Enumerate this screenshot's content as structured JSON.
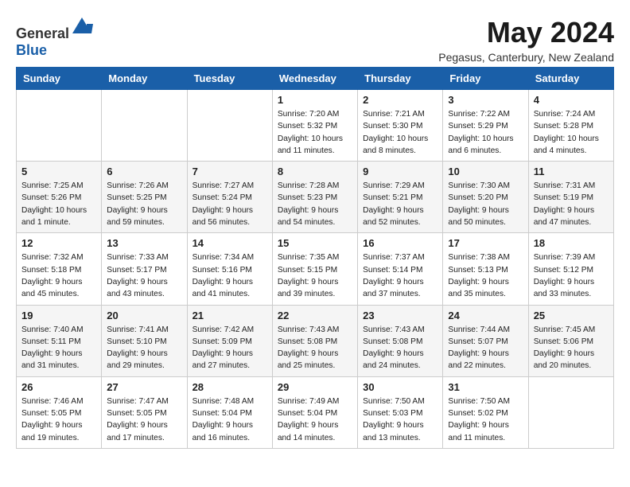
{
  "header": {
    "logo_general": "General",
    "logo_blue": "Blue",
    "title": "May 2024",
    "subtitle": "Pegasus, Canterbury, New Zealand"
  },
  "weekdays": [
    "Sunday",
    "Monday",
    "Tuesday",
    "Wednesday",
    "Thursday",
    "Friday",
    "Saturday"
  ],
  "weeks": [
    [
      {
        "day": "",
        "sunrise": "",
        "sunset": "",
        "daylight": ""
      },
      {
        "day": "",
        "sunrise": "",
        "sunset": "",
        "daylight": ""
      },
      {
        "day": "",
        "sunrise": "",
        "sunset": "",
        "daylight": ""
      },
      {
        "day": "1",
        "sunrise": "Sunrise: 7:20 AM",
        "sunset": "Sunset: 5:32 PM",
        "daylight": "Daylight: 10 hours and 11 minutes."
      },
      {
        "day": "2",
        "sunrise": "Sunrise: 7:21 AM",
        "sunset": "Sunset: 5:30 PM",
        "daylight": "Daylight: 10 hours and 8 minutes."
      },
      {
        "day": "3",
        "sunrise": "Sunrise: 7:22 AM",
        "sunset": "Sunset: 5:29 PM",
        "daylight": "Daylight: 10 hours and 6 minutes."
      },
      {
        "day": "4",
        "sunrise": "Sunrise: 7:24 AM",
        "sunset": "Sunset: 5:28 PM",
        "daylight": "Daylight: 10 hours and 4 minutes."
      }
    ],
    [
      {
        "day": "5",
        "sunrise": "Sunrise: 7:25 AM",
        "sunset": "Sunset: 5:26 PM",
        "daylight": "Daylight: 10 hours and 1 minute."
      },
      {
        "day": "6",
        "sunrise": "Sunrise: 7:26 AM",
        "sunset": "Sunset: 5:25 PM",
        "daylight": "Daylight: 9 hours and 59 minutes."
      },
      {
        "day": "7",
        "sunrise": "Sunrise: 7:27 AM",
        "sunset": "Sunset: 5:24 PM",
        "daylight": "Daylight: 9 hours and 56 minutes."
      },
      {
        "day": "8",
        "sunrise": "Sunrise: 7:28 AM",
        "sunset": "Sunset: 5:23 PM",
        "daylight": "Daylight: 9 hours and 54 minutes."
      },
      {
        "day": "9",
        "sunrise": "Sunrise: 7:29 AM",
        "sunset": "Sunset: 5:21 PM",
        "daylight": "Daylight: 9 hours and 52 minutes."
      },
      {
        "day": "10",
        "sunrise": "Sunrise: 7:30 AM",
        "sunset": "Sunset: 5:20 PM",
        "daylight": "Daylight: 9 hours and 50 minutes."
      },
      {
        "day": "11",
        "sunrise": "Sunrise: 7:31 AM",
        "sunset": "Sunset: 5:19 PM",
        "daylight": "Daylight: 9 hours and 47 minutes."
      }
    ],
    [
      {
        "day": "12",
        "sunrise": "Sunrise: 7:32 AM",
        "sunset": "Sunset: 5:18 PM",
        "daylight": "Daylight: 9 hours and 45 minutes."
      },
      {
        "day": "13",
        "sunrise": "Sunrise: 7:33 AM",
        "sunset": "Sunset: 5:17 PM",
        "daylight": "Daylight: 9 hours and 43 minutes."
      },
      {
        "day": "14",
        "sunrise": "Sunrise: 7:34 AM",
        "sunset": "Sunset: 5:16 PM",
        "daylight": "Daylight: 9 hours and 41 minutes."
      },
      {
        "day": "15",
        "sunrise": "Sunrise: 7:35 AM",
        "sunset": "Sunset: 5:15 PM",
        "daylight": "Daylight: 9 hours and 39 minutes."
      },
      {
        "day": "16",
        "sunrise": "Sunrise: 7:37 AM",
        "sunset": "Sunset: 5:14 PM",
        "daylight": "Daylight: 9 hours and 37 minutes."
      },
      {
        "day": "17",
        "sunrise": "Sunrise: 7:38 AM",
        "sunset": "Sunset: 5:13 PM",
        "daylight": "Daylight: 9 hours and 35 minutes."
      },
      {
        "day": "18",
        "sunrise": "Sunrise: 7:39 AM",
        "sunset": "Sunset: 5:12 PM",
        "daylight": "Daylight: 9 hours and 33 minutes."
      }
    ],
    [
      {
        "day": "19",
        "sunrise": "Sunrise: 7:40 AM",
        "sunset": "Sunset: 5:11 PM",
        "daylight": "Daylight: 9 hours and 31 minutes."
      },
      {
        "day": "20",
        "sunrise": "Sunrise: 7:41 AM",
        "sunset": "Sunset: 5:10 PM",
        "daylight": "Daylight: 9 hours and 29 minutes."
      },
      {
        "day": "21",
        "sunrise": "Sunrise: 7:42 AM",
        "sunset": "Sunset: 5:09 PM",
        "daylight": "Daylight: 9 hours and 27 minutes."
      },
      {
        "day": "22",
        "sunrise": "Sunrise: 7:43 AM",
        "sunset": "Sunset: 5:08 PM",
        "daylight": "Daylight: 9 hours and 25 minutes."
      },
      {
        "day": "23",
        "sunrise": "Sunrise: 7:43 AM",
        "sunset": "Sunset: 5:08 PM",
        "daylight": "Daylight: 9 hours and 24 minutes."
      },
      {
        "day": "24",
        "sunrise": "Sunrise: 7:44 AM",
        "sunset": "Sunset: 5:07 PM",
        "daylight": "Daylight: 9 hours and 22 minutes."
      },
      {
        "day": "25",
        "sunrise": "Sunrise: 7:45 AM",
        "sunset": "Sunset: 5:06 PM",
        "daylight": "Daylight: 9 hours and 20 minutes."
      }
    ],
    [
      {
        "day": "26",
        "sunrise": "Sunrise: 7:46 AM",
        "sunset": "Sunset: 5:05 PM",
        "daylight": "Daylight: 9 hours and 19 minutes."
      },
      {
        "day": "27",
        "sunrise": "Sunrise: 7:47 AM",
        "sunset": "Sunset: 5:05 PM",
        "daylight": "Daylight: 9 hours and 17 minutes."
      },
      {
        "day": "28",
        "sunrise": "Sunrise: 7:48 AM",
        "sunset": "Sunset: 5:04 PM",
        "daylight": "Daylight: 9 hours and 16 minutes."
      },
      {
        "day": "29",
        "sunrise": "Sunrise: 7:49 AM",
        "sunset": "Sunset: 5:04 PM",
        "daylight": "Daylight: 9 hours and 14 minutes."
      },
      {
        "day": "30",
        "sunrise": "Sunrise: 7:50 AM",
        "sunset": "Sunset: 5:03 PM",
        "daylight": "Daylight: 9 hours and 13 minutes."
      },
      {
        "day": "31",
        "sunrise": "Sunrise: 7:50 AM",
        "sunset": "Sunset: 5:02 PM",
        "daylight": "Daylight: 9 hours and 11 minutes."
      },
      {
        "day": "",
        "sunrise": "",
        "sunset": "",
        "daylight": ""
      }
    ]
  ]
}
